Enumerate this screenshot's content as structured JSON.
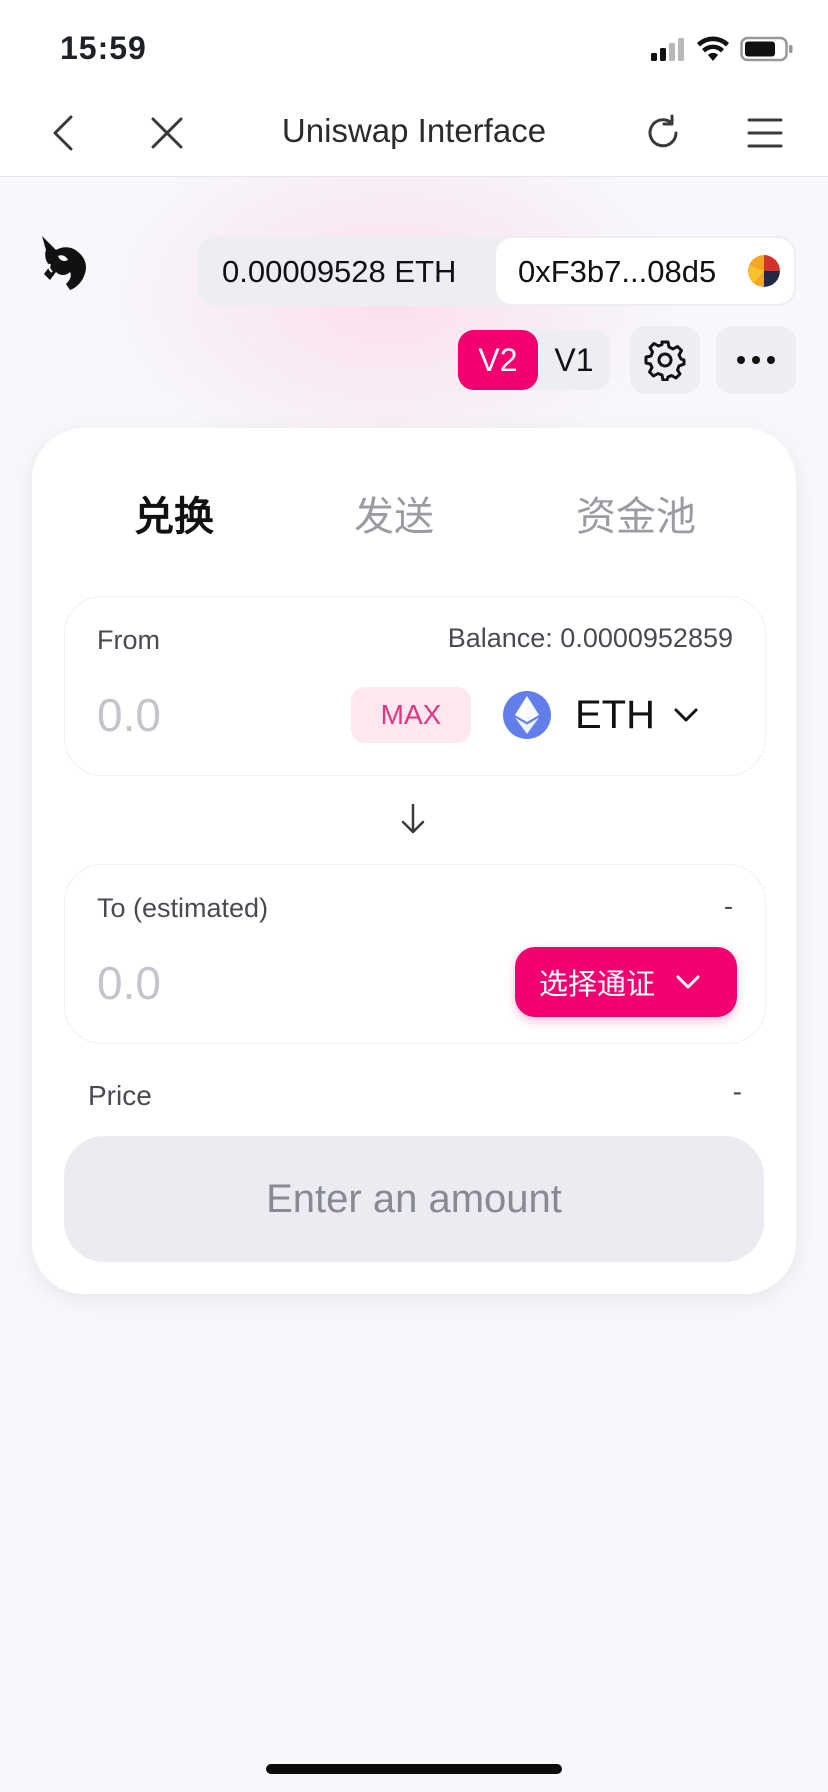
{
  "status_bar": {
    "time": "15:59"
  },
  "browser": {
    "title": "Uniswap Interface"
  },
  "account": {
    "eth_balance": "0.00009528 ETH",
    "address": "0xF3b7...08d5"
  },
  "version": {
    "v2_label": "V2",
    "v1_label": "V1",
    "active": "V2"
  },
  "tabs": [
    {
      "label": "兑换",
      "active": true
    },
    {
      "label": "发送",
      "active": false
    },
    {
      "label": "资金池",
      "active": false
    }
  ],
  "from_panel": {
    "label": "From",
    "balance": "Balance: 0.0000952859",
    "amount_placeholder": "0.0",
    "max_label": "MAX",
    "token_symbol": "ETH"
  },
  "to_panel": {
    "label": "To (estimated)",
    "balance": "-",
    "amount_placeholder": "0.0",
    "select_token_label": "选择通证"
  },
  "price": {
    "label": "Price",
    "value": "-"
  },
  "action_button": {
    "label": "Enter an amount"
  },
  "colors": {
    "accent_pink": "#f2006f",
    "max_bg": "#fde8f1",
    "eth_blue": "#627eea",
    "muted_text": "#9b9ca3"
  }
}
